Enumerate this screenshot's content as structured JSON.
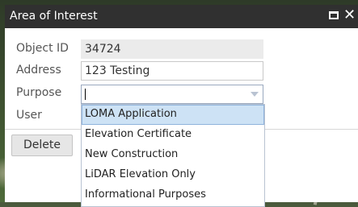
{
  "dialog": {
    "title": "Area of Interest",
    "icons": {
      "maximize": "maximize-icon",
      "close": "close-icon",
      "close_glyph": "✕"
    }
  },
  "fields": {
    "object_id": {
      "label": "Object ID",
      "value": "34724"
    },
    "address": {
      "label": "Address",
      "value": "123 Testing"
    },
    "purpose": {
      "label": "Purpose",
      "value": ""
    },
    "user": {
      "label": "User"
    }
  },
  "actions": {
    "delete_label": "Delete"
  },
  "purpose_options": [
    "LOMA Application",
    "Elevation Certificate",
    "New Construction",
    "LiDAR Elevation Only",
    "Informational Purposes"
  ],
  "purpose_selected_index": 0,
  "colors": {
    "titlebar": "#303030",
    "highlight": "#cde2f5",
    "highlight_border": "#8fb3dc"
  }
}
